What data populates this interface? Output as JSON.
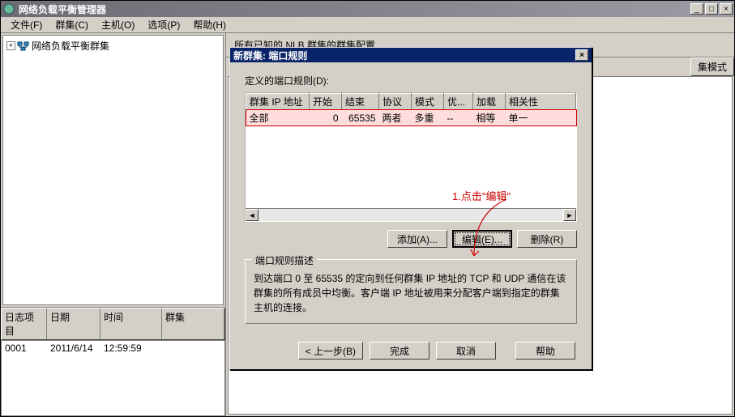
{
  "window": {
    "title": "网络负载平衡管理器",
    "menu": [
      "文件(F)",
      "群集(C)",
      "主机(O)",
      "选项(P)",
      "帮助(H)"
    ],
    "tree_root": "网络负载平衡群集",
    "top_label": "所有已知的 NLB 群集的群集配置",
    "list_col_truncated": "集模式"
  },
  "log": {
    "cols": [
      "日志项目",
      "日期",
      "时间",
      "群集"
    ],
    "row": {
      "id": "0001",
      "date": "2011/6/14",
      "time": "12:59:59",
      "cluster": ""
    }
  },
  "dialog": {
    "title": "新群集:  端口规则",
    "field_label": "定义的端口规则(D):",
    "cols": [
      "群集 IP 地址",
      "开始",
      "结束",
      "协议",
      "模式",
      "优...",
      "加载",
      "相关性"
    ],
    "row": {
      "ip": "全部",
      "start": "0",
      "end": "65535",
      "proto": "两者",
      "mode": "多重",
      "pri": "--",
      "load": "相等",
      "aff": "单一"
    },
    "btn_add": "添加(A)...",
    "btn_edit": "编辑(E)...",
    "btn_remove": "删除(R)",
    "group_title": "端口规则描述",
    "desc": "到达端口 0 至 65535 的定向到任何群集 IP 地址的 TCP 和 UDP 通信在该群集的所有成员中均衡。客户端 IP 地址被用来分配客户端到指定的群集主机的连接。",
    "btn_back": "< 上一步(B)",
    "btn_finish": "完成",
    "btn_cancel": "取消",
    "btn_help": "帮助"
  },
  "annotation": "1.点击\"编辑\""
}
